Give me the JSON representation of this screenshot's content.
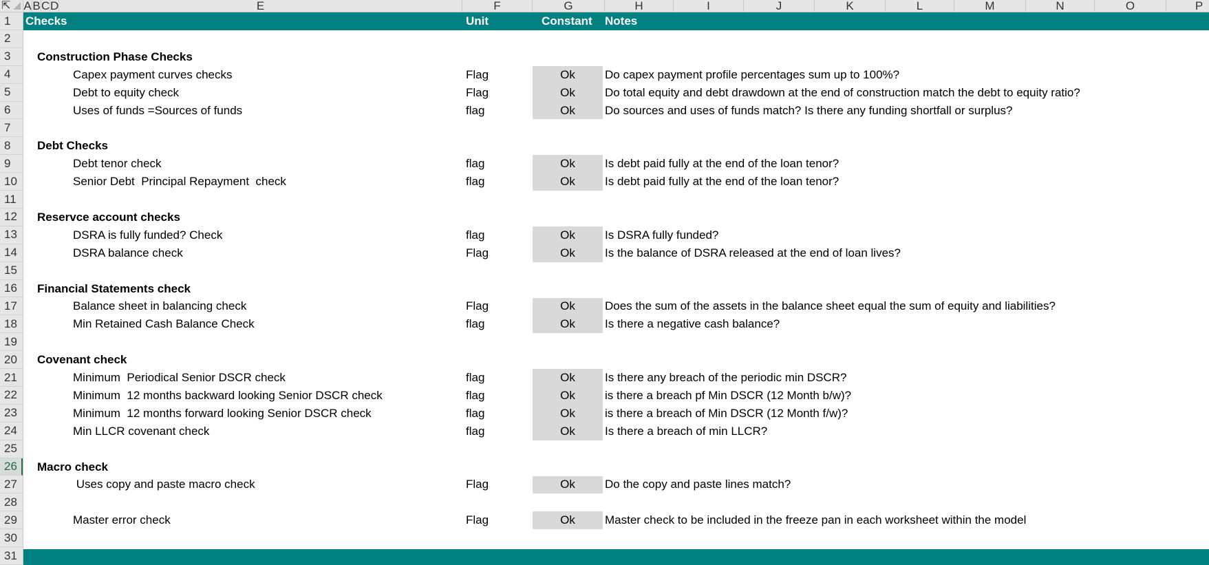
{
  "columns": [
    {
      "letter": "A"
    },
    {
      "letter": "B"
    },
    {
      "letter": "C"
    },
    {
      "letter": "D"
    },
    {
      "letter": "E"
    },
    {
      "letter": "F"
    },
    {
      "letter": "G"
    },
    {
      "letter": "H"
    },
    {
      "letter": "I"
    },
    {
      "letter": "J"
    },
    {
      "letter": "K"
    },
    {
      "letter": "L"
    },
    {
      "letter": "M"
    },
    {
      "letter": "N"
    },
    {
      "letter": "O"
    },
    {
      "letter": "P"
    }
  ],
  "row_numbers": [
    "2",
    "3",
    "4",
    "5",
    "6",
    "7",
    "8",
    "9",
    "10",
    "11",
    "12",
    "13",
    "14",
    "15",
    "16",
    "17",
    "18",
    "19",
    "20",
    "21",
    "22",
    "23",
    "24",
    "25",
    "26",
    "27",
    "28",
    "29",
    "30",
    "31"
  ],
  "header_row_number": "1",
  "active_row": "26",
  "header": {
    "checks": "Checks",
    "unit": "Unit",
    "constant": "Constant",
    "notes": "Notes"
  },
  "colors": {
    "band": "#008080",
    "ok_fill": "#d9d9d9",
    "active_row_text": "#1e6b45"
  },
  "rows": [
    {
      "row": "3",
      "type": "section",
      "label": "Construction Phase Checks"
    },
    {
      "row": "4",
      "type": "check",
      "label": "Capex payment curves checks",
      "unit": "Flag",
      "status": "Ok",
      "note": "Do capex payment profile percentages sum up to 100%?"
    },
    {
      "row": "5",
      "type": "check",
      "label": "Debt to equity check",
      "unit": "Flag",
      "status": "Ok",
      "note": "Do total equity and debt drawdown at the end of construction match the debt to equity ratio?"
    },
    {
      "row": "6",
      "type": "check",
      "label": "Uses of funds =Sources of funds",
      "unit": "flag",
      "status": "Ok",
      "note": "Do sources and uses of funds match? Is there any funding shortfall or surplus?"
    },
    {
      "row": "8",
      "type": "section",
      "label": "Debt Checks"
    },
    {
      "row": "9",
      "type": "check",
      "label": "Debt tenor check",
      "unit": "flag",
      "status": "Ok",
      "note": "Is debt paid fully at the end of the loan tenor?"
    },
    {
      "row": "10",
      "type": "check",
      "label": "Senior Debt  Principal Repayment  check",
      "unit": "flag",
      "status": "Ok",
      "note": "Is debt paid fully at the end of the loan tenor?"
    },
    {
      "row": "12",
      "type": "section",
      "label": "Reservce account checks"
    },
    {
      "row": "13",
      "type": "check",
      "label": "DSRA is fully funded? Check",
      "unit": "flag",
      "status": "Ok",
      "note": "Is DSRA fully funded?"
    },
    {
      "row": "14",
      "type": "check",
      "label": "DSRA balance check",
      "unit": "Flag",
      "status": "Ok",
      "note": "Is the balance of DSRA released at the end of loan lives?"
    },
    {
      "row": "16",
      "type": "section",
      "label": "Financial Statements check"
    },
    {
      "row": "17",
      "type": "check",
      "label": "Balance sheet in balancing check",
      "unit": "Flag",
      "status": "Ok",
      "note": "Does the sum of the assets in the balance sheet equal the sum of equity and liabilities?"
    },
    {
      "row": "18",
      "type": "check",
      "label": "Min Retained Cash Balance Check",
      "unit": "flag",
      "status": "Ok",
      "note": "Is there a negative cash balance?"
    },
    {
      "row": "20",
      "type": "section",
      "label": "Covenant check"
    },
    {
      "row": "21",
      "type": "check",
      "label": "Minimum  Periodical Senior DSCR check",
      "unit": "flag",
      "status": "Ok",
      "note": "Is there any breach of the periodic min DSCR?"
    },
    {
      "row": "22",
      "type": "check",
      "label": "Minimum  12 months backward looking Senior DSCR check",
      "unit": "flag",
      "status": "Ok",
      "note": "is there a breach pf Min DSCR (12 Month b/w)?"
    },
    {
      "row": "23",
      "type": "check",
      "label": "Minimum  12 months forward looking Senior DSCR check",
      "unit": "flag",
      "status": "Ok",
      "note": "is there a breach of Min DSCR (12 Month f/w)?"
    },
    {
      "row": "24",
      "type": "check",
      "label": "Min LLCR covenant check",
      "unit": "flag",
      "status": "Ok",
      "note": "Is there a breach of min LLCR?"
    },
    {
      "row": "26",
      "type": "section",
      "label": "Macro check"
    },
    {
      "row": "27",
      "type": "check",
      "label": " Uses copy and paste macro check",
      "unit": "Flag",
      "status": "Ok",
      "note": "Do the copy and paste lines match?"
    },
    {
      "row": "29",
      "type": "check",
      "label": "Master error check",
      "unit": "Flag",
      "status": "Ok",
      "note": "Master check to be included in the freeze pan in each worksheet within the model"
    }
  ]
}
